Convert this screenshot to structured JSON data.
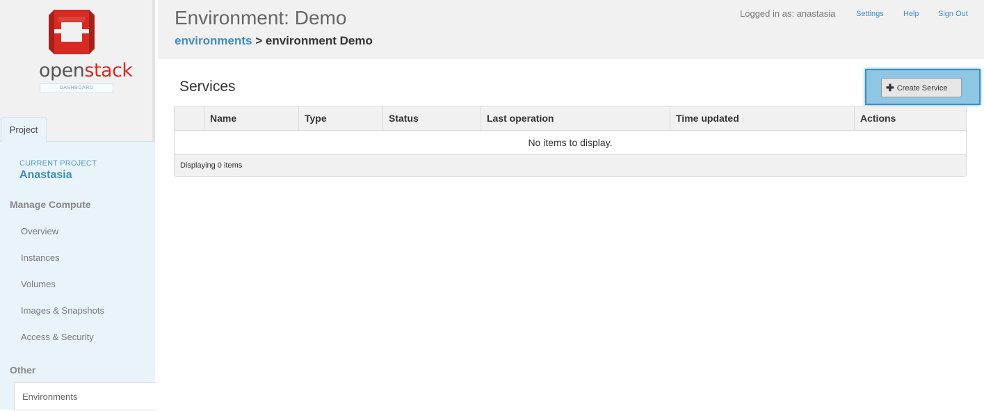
{
  "logo": {
    "word_left": "open",
    "word_right": "stack",
    "subtitle": "DASHBOARD",
    "colors": {
      "red": "#d62b23",
      "gray": "#555555"
    }
  },
  "sidebar": {
    "tab": "Project",
    "current_project_label": "CURRENT PROJECT",
    "current_project_name": "Anastasia",
    "sections": [
      {
        "title": "Manage Compute",
        "items": [
          "Overview",
          "Instances",
          "Volumes",
          "Images & Snapshots",
          "Access & Security"
        ]
      },
      {
        "title": "Other",
        "items": [
          "Environments"
        ]
      }
    ],
    "active_item": "Environments"
  },
  "header": {
    "title": "Environment: Demo",
    "breadcrumb_link": "environments",
    "breadcrumb_sep": ">",
    "breadcrumb_current": "environment Demo",
    "user_info": "Logged in as: anastasia",
    "links": [
      "Settings",
      "Help",
      "Sign Out"
    ]
  },
  "main": {
    "section_title": "Services",
    "create_button": "Create Service",
    "table": {
      "columns": [
        "",
        "Name",
        "Type",
        "Status",
        "Last operation",
        "Time updated",
        "Actions"
      ],
      "empty_message": "No items to display.",
      "footer": "Displaying 0 items"
    }
  },
  "colors": {
    "accent": "#3f8cc6",
    "highlight": "#8ec6e4",
    "sidebar_panel": "#e8f4fa"
  }
}
